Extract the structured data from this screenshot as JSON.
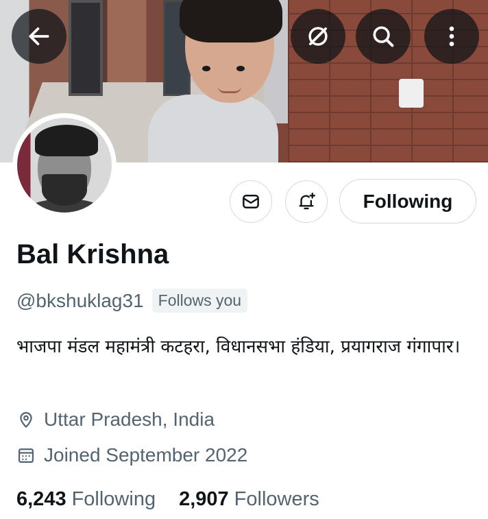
{
  "header": {
    "back_icon": "arrow-left-icon",
    "grok_icon": "slash-circle-icon",
    "search_icon": "search-icon",
    "more_icon": "more-vertical-icon"
  },
  "profile": {
    "name": "Bal Krishna",
    "handle": "@bkshuklag31",
    "follows_you": "Follows you",
    "bio": "भाजपा मंडल महामंत्री कटहरा, विधानसभा हंडिया, प्रयागराज गंगापार।",
    "location": "Uttar Pradesh, India",
    "joined": "Joined September 2022",
    "following_count": "6,243",
    "following_label": "Following",
    "followers_count": "2,907",
    "followers_label": "Followers"
  },
  "actions": {
    "message_icon": "mail-icon",
    "notify_icon": "bell-plus-icon",
    "follow_button_label": "Following"
  },
  "colors": {
    "primary_text": "#0f1419",
    "secondary_text": "#536471",
    "border": "#cfd9de",
    "badge_bg": "#eff3f4"
  }
}
